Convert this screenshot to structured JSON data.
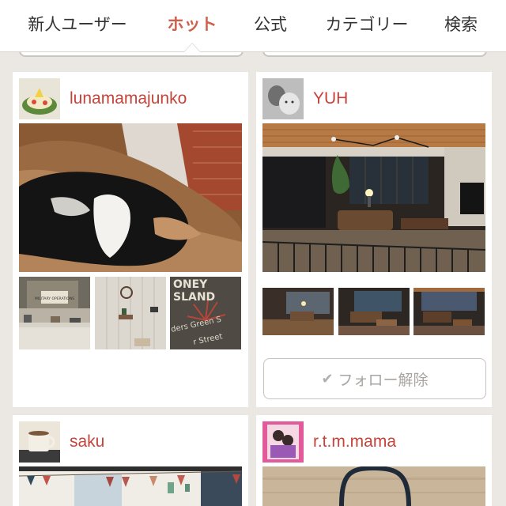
{
  "tabs": [
    {
      "label": "新人ユーザー",
      "active": false
    },
    {
      "label": "ホット",
      "active": true
    },
    {
      "label": "公式",
      "active": false
    },
    {
      "label": "カテゴリー",
      "active": false
    },
    {
      "label": "検索",
      "active": false
    }
  ],
  "cards": [
    {
      "username": "lunamamajunko"
    },
    {
      "username": "YUH",
      "follow_button": "フォロー解除"
    },
    {
      "username": "saku"
    },
    {
      "username": "r.t.m.mama"
    }
  ],
  "photo_text": {
    "thumb3_line1": "ONEY",
    "thumb3_line2": "SLAND",
    "thumb3_line3": "ders Green S",
    "thumb3_line4": "r Street",
    "thumb1_sign": "MILITARY OPERATIONS"
  },
  "icons": {
    "follow_check": "check-icon"
  },
  "colors": {
    "accent": "#d0604c",
    "username": "#c6433a",
    "background": "#ebe8e3"
  }
}
